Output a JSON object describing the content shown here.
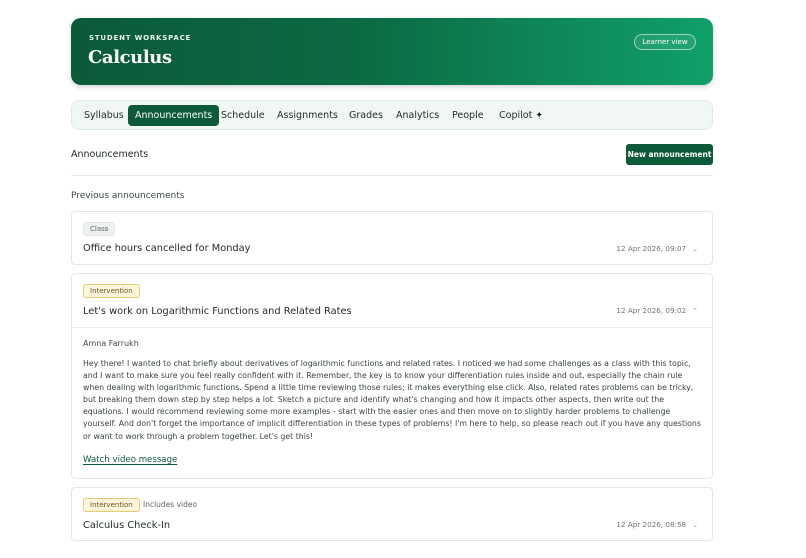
{
  "header": {
    "eyebrow": "STUDENT WORKSPACE",
    "title": "Calculus",
    "view_pill": "Learner view"
  },
  "tabs": [
    {
      "label": "Syllabus",
      "active": false
    },
    {
      "label": "Announcements",
      "active": true
    },
    {
      "label": "Schedule",
      "active": false
    },
    {
      "label": "Assignments",
      "active": false
    },
    {
      "label": "Grades",
      "active": false
    },
    {
      "label": "Analytics",
      "active": false
    },
    {
      "label": "People",
      "active": false
    },
    {
      "label": "Copilot ✦",
      "active": false
    }
  ],
  "section": {
    "title": "Announcements",
    "new_button": "New announcement",
    "previous_label": "Previous announcements"
  },
  "announcements": [
    {
      "tag": "Class",
      "title": "Office hours cancelled for Monday",
      "timestamp": "12 Apr 2026, 09:07",
      "expanded": false
    },
    {
      "tag": "Intervention",
      "title": "Let's work on Logarithmic Functions and Related Rates",
      "timestamp": "12 Apr 2026, 09:02",
      "expanded": true,
      "author": "Amna Farrukh",
      "body": "Hey there! I wanted to chat briefly about derivatives of logarithmic functions and related rates. I noticed we had some challenges as a class with this topic, and I want to make sure you feel really confident with it. Remember, the key is to know your differentiation rules inside and out, especially the chain rule when dealing with logarithmic functions. Spend a little time reviewing those rules; it makes everything else click. Also, related rates problems can be tricky, but breaking them down step by step helps a lot. Sketch a picture and identify what's changing and how it impacts other aspects, then write out the equations. I would recommend reviewing some more examples - start with the easier ones and then move on to slightly harder problems to challenge yourself. And don't forget the importance of implicit differentiation in these types of problems! I'm here to help, so please reach out if you have any questions or want to work through a problem together. Let's get this!",
      "link": "Watch video message"
    },
    {
      "tag": "Intervention",
      "extra": "Includes video",
      "title": "Calculus Check-In",
      "timestamp": "12 Apr 2026, 08:58",
      "expanded": false
    }
  ],
  "icons": {
    "chevron_down": "⌄",
    "chevron_up": "⌃"
  },
  "colors": {
    "brand": "#0d5a3a",
    "brand_light": "#10a06a",
    "intervention_bg": "#fff6dc"
  }
}
